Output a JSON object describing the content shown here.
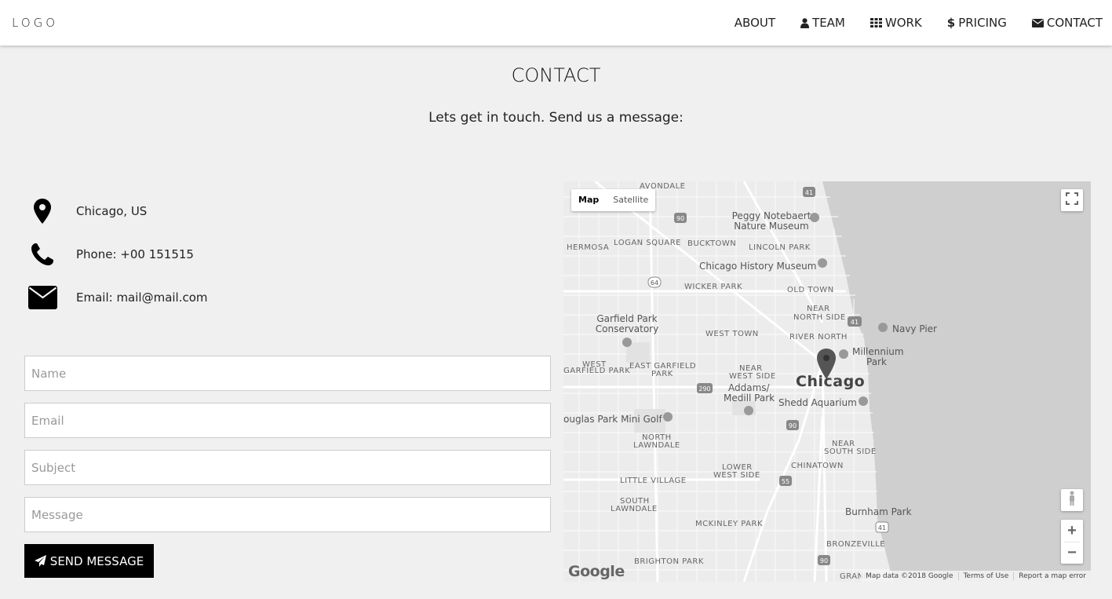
{
  "nav": {
    "logo": "LOGO",
    "items": [
      {
        "label": "ABOUT",
        "icon": ""
      },
      {
        "label": "TEAM",
        "icon": "user-icon"
      },
      {
        "label": "WORK",
        "icon": "grid-icon"
      },
      {
        "label": "PRICING",
        "icon": "dollar-icon"
      },
      {
        "label": "CONTACT",
        "icon": "envelope-icon"
      }
    ]
  },
  "contact": {
    "title": "CONTACT",
    "subtitle": "Lets get in touch. Send us a message:"
  },
  "info": {
    "location": "Chicago, US",
    "phone": "Phone: +00 151515",
    "email": "Email: mail@mail.com"
  },
  "form": {
    "name_placeholder": "Name",
    "email_placeholder": "Email",
    "subject_placeholder": "Subject",
    "message_placeholder": "Message",
    "send_label": "SEND MESSAGE"
  },
  "map": {
    "type_map": "Map",
    "type_satellite": "Satellite",
    "city": "Chicago",
    "labels": {
      "avondale": "AVONDALE",
      "hermosa": "HERMOSA",
      "logan_square": "LOGAN SQUARE",
      "bucktown": "BUCKTOWN",
      "lincoln_park": "LINCOLN PARK",
      "peggy": "Peggy Notebaert",
      "nature_museum": "Nature Museum",
      "history_museum": "Chicago History Museum",
      "wicker_park": "WICKER PARK",
      "old_town": "OLD TOWN",
      "near_north": "NEAR",
      "near_north2": "NORTH SIDE",
      "navy_pier": "Navy Pier",
      "garfield_cons": "Garfield Park",
      "garfield_cons2": "Conservatory",
      "west_town": "WEST TOWN",
      "river_north": "RIVER NORTH",
      "millennium": "Millennium",
      "millennium2": "Park",
      "west": "WEST",
      "garfield_park": "GARFIELD PARK",
      "east_garfield": "EAST GARFIELD",
      "east_garfield2": "PARK",
      "near_west": "NEAR",
      "near_west2": "WEST SIDE",
      "addams": "Addams/",
      "addams2": "Medill Park",
      "shedd": "Shedd Aquarium",
      "douglas": "ouglas Park Mini Golf",
      "north_lawndale": "NORTH",
      "north_lawndale2": "LAWNDALE",
      "near_south": "NEAR",
      "near_south2": "SOUTH SIDE",
      "chinatown": "CHINATOWN",
      "lower_west": "LOWER",
      "lower_west2": "WEST SIDE",
      "little_village": "LITTLE VILLAGE",
      "south_lawndale": "SOUTH",
      "south_lawndale2": "LAWNDALE",
      "burnham": "Burnham Park",
      "mckinley": "MCKINLEY PARK",
      "bronzeville": "BRONZEVILLE",
      "brighton": "BRIGHTON PARK",
      "grand": "GRAND"
    },
    "shields": [
      "41",
      "90",
      "64",
      "41",
      "290",
      "90",
      "55",
      "41",
      "90"
    ],
    "google": "Google",
    "attribution": [
      "Map data ©2018 Google",
      "Terms of Use",
      "Report a map error"
    ]
  }
}
